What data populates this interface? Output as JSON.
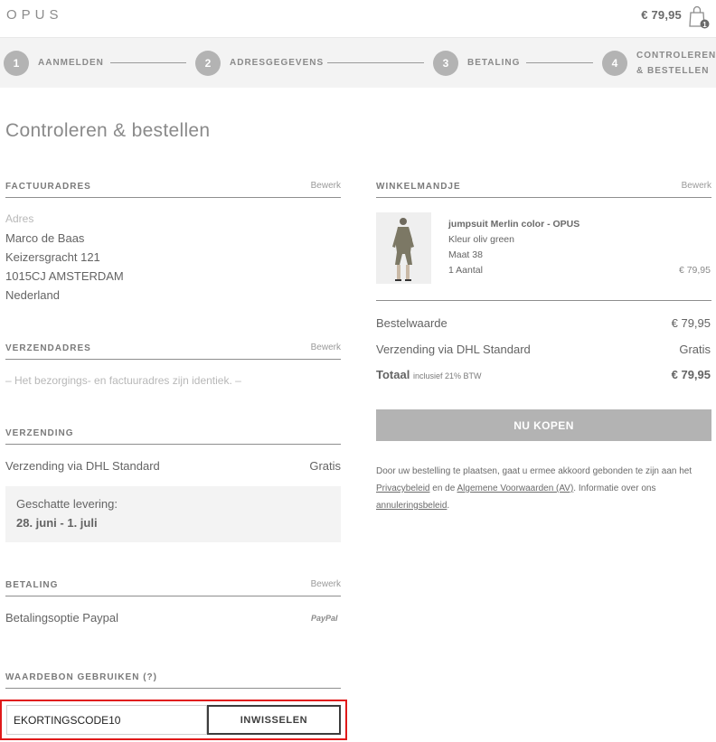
{
  "header": {
    "logo": "OPUS",
    "cart_total": "€ 79,95",
    "cart_count": "1"
  },
  "steps": [
    {
      "number": "1",
      "label": "AANMELDEN"
    },
    {
      "number": "2",
      "label": "ADRESGEGEVENS"
    },
    {
      "number": "3",
      "label": "BETALING"
    },
    {
      "number": "4",
      "label_line1": "CONTROLEREN",
      "label_line2": "& BESTELLEN"
    }
  ],
  "page_title": "Controleren & bestellen",
  "billing": {
    "title": "FACTUURADRES",
    "edit": "Bewerk",
    "label": "Adres",
    "name": "Marco de Baas",
    "street": "Keizersgracht 121",
    "city": "1015CJ AMSTERDAM",
    "country": "Nederland"
  },
  "shipping_address": {
    "title": "VERZENDADRES",
    "edit": "Bewerk",
    "note": "– Het bezorgings- en factuuradres zijn identiek. –"
  },
  "shipping": {
    "title": "VERZENDING",
    "method": "Verzending via DHL Standard",
    "price": "Gratis",
    "estimate_label": "Geschatte levering:",
    "estimate_value": "28. juni - 1. juli"
  },
  "payment": {
    "title": "BETALING",
    "edit": "Bewerk",
    "method": "Betalingsoptie Paypal",
    "logo": "PayPal"
  },
  "voucher": {
    "title": "WAARDEBON GEBRUIKEN (?)",
    "value": "EKORTINGSCODE10",
    "button": "INWISSELEN"
  },
  "cart": {
    "title": "WINKELMANDJE",
    "edit": "Bewerk",
    "item": {
      "name": "jumpsuit Merlin color - OPUS",
      "color": "Kleur oliv green",
      "size": "Maat 38",
      "quantity": "1 Aantal",
      "price": "€ 79,95"
    },
    "subtotal_label": "Bestelwaarde",
    "subtotal_value": "€ 79,95",
    "shipping_label": "Verzending via DHL Standard",
    "shipping_value": "Gratis",
    "total_label": "Totaal",
    "total_note": "inclusief 21% BTW",
    "total_value": "€ 79,95"
  },
  "buy_button": "NU KOPEN",
  "legal": {
    "text1": "Door uw bestelling te plaatsen, gaat u ermee akkoord gebonden te zijn aan het ",
    "privacy": "Privacybeleid",
    "text2": " en de ",
    "terms": "Algemene Voorwaarden (AV)",
    "text3": ". Informatie over ons ",
    "cancellation": "annuleringsbeleid",
    "text4": "."
  },
  "colors": {
    "accent_gray": "#b3b3b3",
    "highlight_red": "#e01919",
    "text": "#646464"
  }
}
